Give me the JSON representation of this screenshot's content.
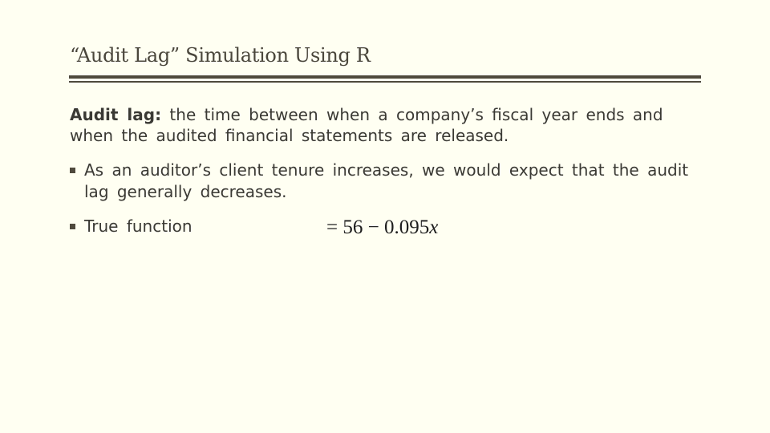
{
  "slide": {
    "title": "“Audit Lag” Simulation Using R",
    "definition": {
      "term": "Audit lag:",
      "text": " the time between when a company’s fiscal year ends and when the audited financial statements are released."
    },
    "bullets": [
      {
        "text": "As an auditor’s client tenure increases, we would expect that the audit lag generally decreases."
      },
      {
        "text": "True function"
      }
    ],
    "formula": {
      "expression": "= 56 − 0.095",
      "variable": "x"
    }
  }
}
